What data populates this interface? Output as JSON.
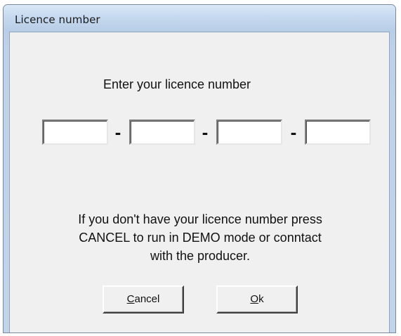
{
  "window": {
    "title": "Licence number"
  },
  "dialog": {
    "prompt": "Enter your licence number",
    "fields": [
      "",
      "",
      "",
      ""
    ],
    "separator": "-",
    "info_lines": [
      "If you don't have your licence number press",
      "CANCEL to run in DEMO mode or conntact",
      "with the producer."
    ]
  },
  "buttons": {
    "cancel": {
      "accel": "C",
      "rest": "ancel"
    },
    "ok": {
      "accel": "O",
      "rest": "k"
    }
  }
}
